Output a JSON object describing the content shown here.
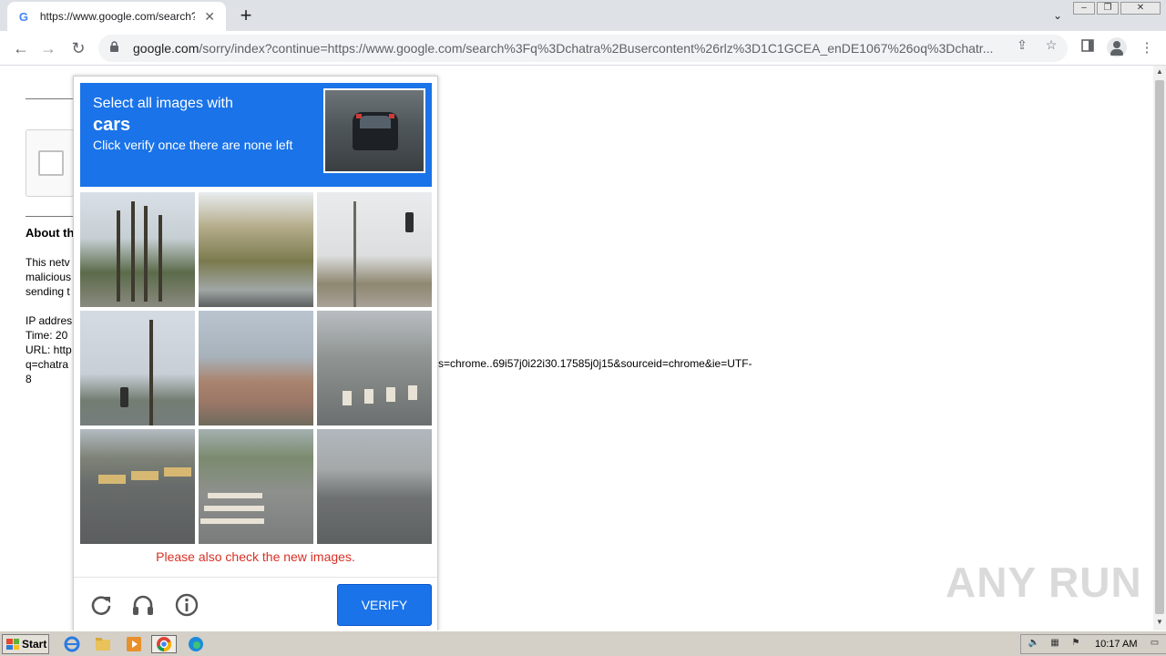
{
  "browser": {
    "tab_title": "https://www.google.com/search?q=chatra",
    "favicon_letter": "G",
    "tab_close": "✕",
    "new_tab": "+",
    "url_host": "google.com",
    "url_rest": "/sorry/index?continue=https://www.google.com/search%3Fq%3Dchatra%2Busercontent%26rlz%3D1C1GCEA_enDE1067%26oq%3Dchatr..."
  },
  "page": {
    "about_heading": "About th",
    "para_lines": [
      "This netv",
      "malicious",
      "sending t"
    ],
    "ip_lines": [
      "IP addres",
      "Time: 20",
      "URL: http",
      "q=chatra",
      "8"
    ],
    "url_tail": "s=chrome..69i57j0i22i30.17585j0j15&sourceid=chrome&ie=UTF-"
  },
  "challenge": {
    "line1": "Select all images with",
    "target": "cars",
    "subtitle": "Click verify once there are none left",
    "notice": "Please also check the new images.",
    "verify_label": "VERIFY",
    "tiles": [
      "trees",
      "hills",
      "light",
      "palm",
      "house",
      "cross",
      "road1",
      "road2",
      "road3"
    ]
  },
  "watermark": "ANY RUN",
  "taskbar": {
    "start_label": "Start",
    "clock": "10:17 AM"
  },
  "icons": {
    "reload": "reload-icon",
    "audio": "headphones-icon",
    "info": "info-icon"
  },
  "colors": {
    "accent": "#1a73e8",
    "error": "#d93025"
  }
}
